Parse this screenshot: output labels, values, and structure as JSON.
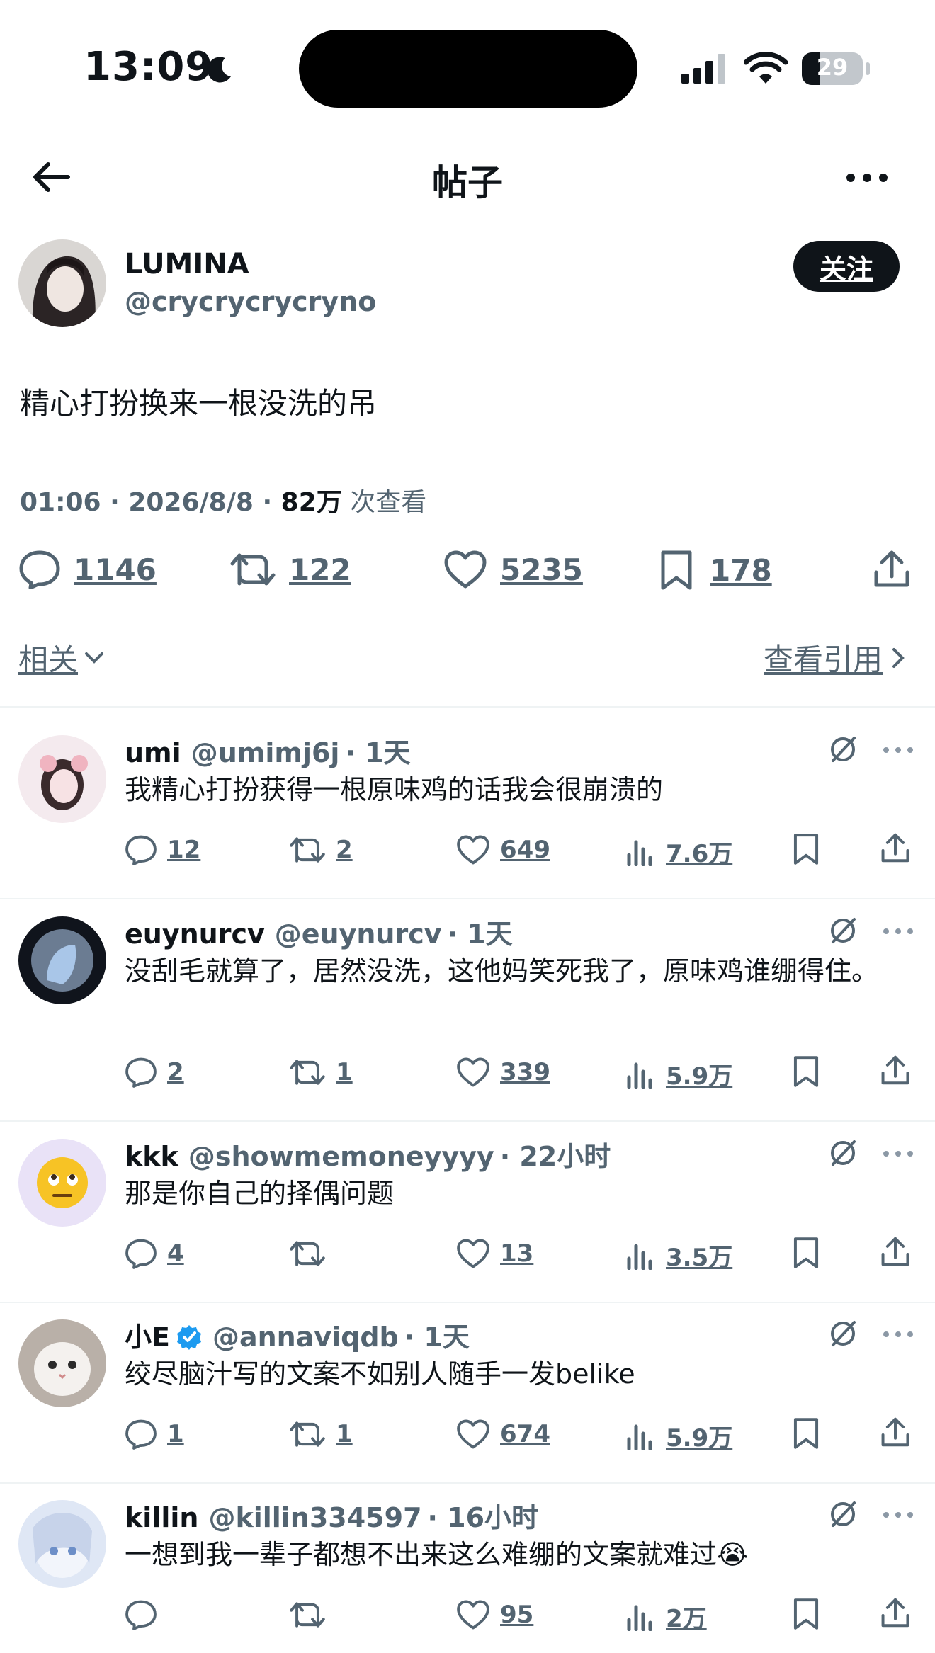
{
  "status_bar": {
    "time": "13:09",
    "battery": "29"
  },
  "header": {
    "title": "帖子"
  },
  "post": {
    "author": {
      "name": "LUMINA",
      "handle": "@crycrycrycryno"
    },
    "follow_label": "关注",
    "text": "精心打扮换来一根没洗的吊",
    "meta": {
      "datetime": "01:06 · 2026/8/8 · ",
      "views": "82万",
      "views_label": " 次查看"
    },
    "stats": {
      "replies": "1146",
      "reposts": "122",
      "likes": "5235",
      "bookmarks": "178"
    },
    "related_label": "相关",
    "quotes_label": "查看引用"
  },
  "replies": [
    {
      "name": "umi",
      "handle": "@umimj6j",
      "time": "· 1天",
      "text": "我精心打扮获得一根原味鸡的话我会很崩溃的",
      "replies": "12",
      "reposts": "2",
      "likes": "649",
      "views": "7.6万"
    },
    {
      "name": "euynurcv",
      "handle": "@euynurcv",
      "time": "· 1天",
      "text": "没刮毛就算了，居然没洗，这他妈笑死我了，原味鸡谁绷得住。",
      "replies": "2",
      "reposts": "1",
      "likes": "339",
      "views": "5.9万"
    },
    {
      "name": "kkk",
      "handle": "@showmemoneyyyy",
      "time": "· 22小时",
      "text": "那是你自己的择偶问题",
      "replies": "4",
      "reposts": "",
      "likes": "13",
      "views": "3.5万"
    },
    {
      "name": "小E",
      "handle": "@annaviqdb",
      "time": "· 1天",
      "text": "绞尽脑汁写的文案不如别人随手一发belike",
      "replies": "1",
      "reposts": "1",
      "likes": "674",
      "views": "5.9万"
    },
    {
      "name": "killin",
      "handle": "@killin334597",
      "time": "· 16小时",
      "text": "一想到我一辈子都想不出来这么难绷的文案就难过😭",
      "replies": "",
      "reposts": "",
      "likes": "95",
      "views": "2万"
    }
  ],
  "colors": {
    "text": "#0f1419",
    "secondary": "#536471",
    "divider": "#eff3f4",
    "verified": "#1d9bf0"
  }
}
